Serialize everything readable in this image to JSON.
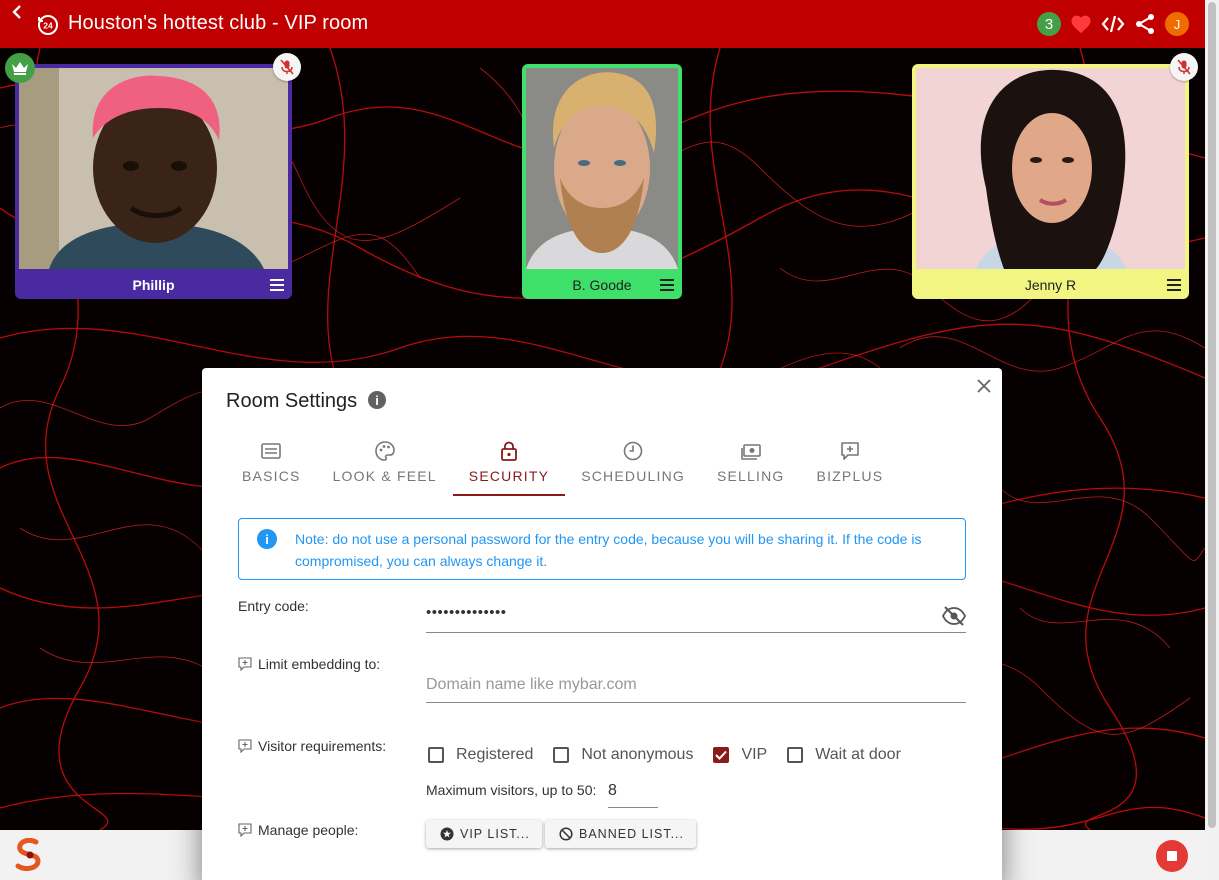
{
  "header": {
    "title": "Houston's hottest club - VIP room",
    "count_badge": "3",
    "avatar_initial": "J",
    "bar_color": "#c00000"
  },
  "participants": [
    {
      "name": "Phillip",
      "frame_color": "#4a2aa0",
      "name_color": "#ffffff",
      "host": true,
      "muted": true
    },
    {
      "name": "B. Goode",
      "frame_color": "#3ee06a",
      "name_color": "#222222",
      "host": false,
      "muted": false
    },
    {
      "name": "Jenny R",
      "frame_color": "#f3f582",
      "name_color": "#222222",
      "host": false,
      "muted": true
    }
  ],
  "dialog": {
    "title": "Room Settings",
    "tabs": [
      {
        "label": "BASICS",
        "icon": "list-box-icon"
      },
      {
        "label": "LOOK & FEEL",
        "icon": "palette-icon"
      },
      {
        "label": "SECURITY",
        "icon": "lock-icon",
        "active": true
      },
      {
        "label": "SCHEDULING",
        "icon": "clock-icon"
      },
      {
        "label": "SELLING",
        "icon": "cash-icon"
      },
      {
        "label": "BIZPLUS",
        "icon": "comment-plus-icon"
      }
    ],
    "note": "Note: do not use a personal password for the entry code, because you will be sharing it. If the code is compromised, you can always change it.",
    "entry_code": {
      "label": "Entry code:",
      "value": "••••••••••••••"
    },
    "embedding": {
      "label": "Limit embedding to:",
      "placeholder": "Domain name like mybar.com"
    },
    "visitor_requirements": {
      "label": "Visitor requirements:",
      "options": [
        {
          "label": "Registered",
          "checked": false
        },
        {
          "label": "Not anonymous",
          "checked": false
        },
        {
          "label": "VIP",
          "checked": true
        },
        {
          "label": "Wait at door",
          "checked": false
        }
      ]
    },
    "max_visitors": {
      "label": "Maximum visitors, up to 50:",
      "value": "8"
    },
    "manage_people": {
      "label": "Manage people:",
      "vip_button": "VIP LIST...",
      "banned_button": "BANNED LIST..."
    },
    "accent_color": "#8b1a1a",
    "info_color": "#2196f3"
  }
}
